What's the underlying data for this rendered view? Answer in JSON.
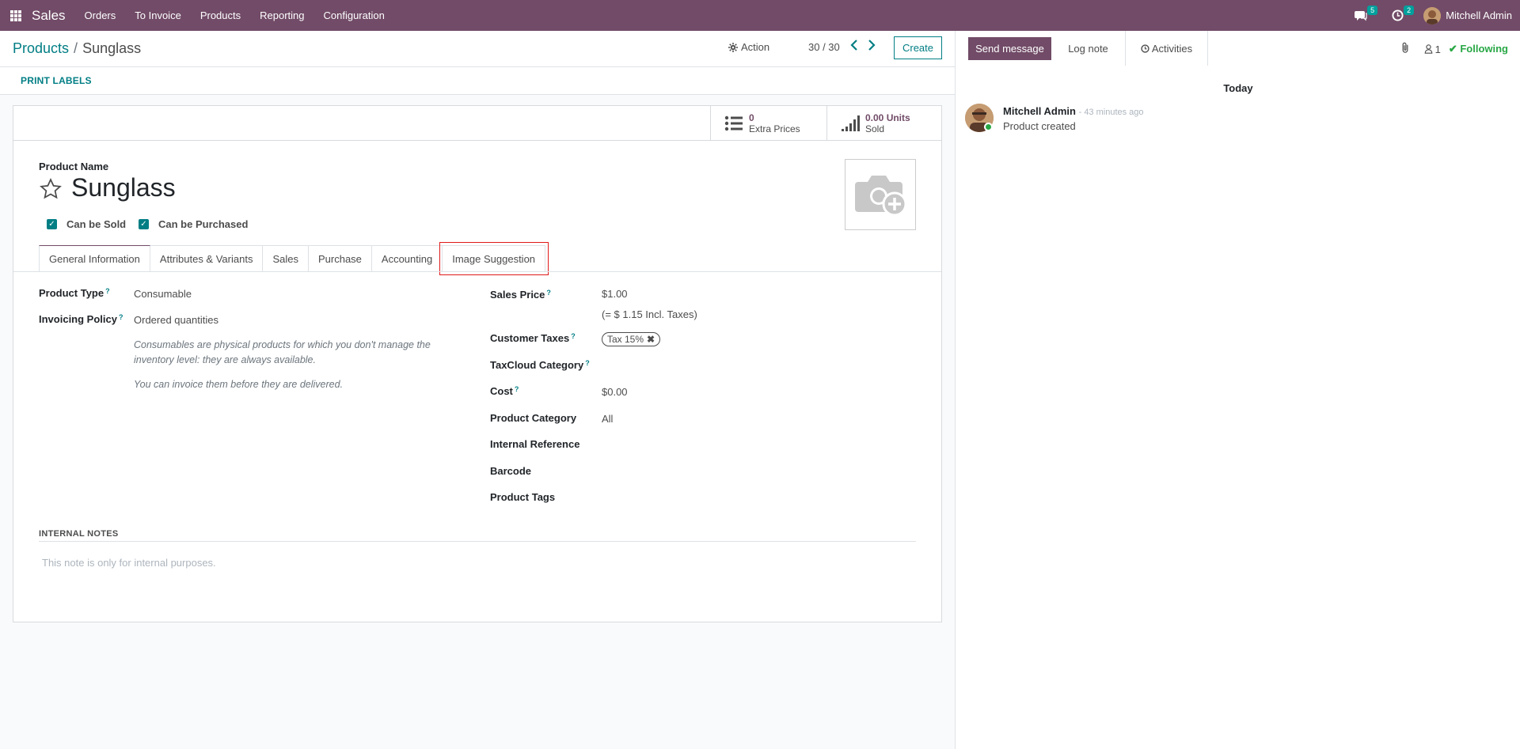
{
  "navbar": {
    "brand": "Sales",
    "menu": [
      "Orders",
      "To Invoice",
      "Products",
      "Reporting",
      "Configuration"
    ],
    "messages_count": "5",
    "activities_count": "2",
    "user": "Mitchell Admin"
  },
  "control": {
    "breadcrumb_parent": "Products",
    "breadcrumb_sep": "/",
    "breadcrumb_current": "Sunglass",
    "action_label": "Action",
    "pager": "30 / 30",
    "create_label": "Create"
  },
  "statusbar": {
    "print_labels": "PRINT LABELS"
  },
  "smart_buttons": {
    "extra_prices_value": "0",
    "extra_prices_label": "Extra Prices",
    "sold_value": "0.00 Units",
    "sold_label": "Sold"
  },
  "product": {
    "name_label": "Product Name",
    "name": "Sunglass",
    "can_be_sold": "Can be Sold",
    "can_be_purchased": "Can be Purchased"
  },
  "tabs": [
    "General Information",
    "Attributes & Variants",
    "Sales",
    "Purchase",
    "Accounting",
    "Image Suggestion"
  ],
  "fields": {
    "product_type_label": "Product Type",
    "product_type": "Consumable",
    "invoicing_policy_label": "Invoicing Policy",
    "invoicing_policy": "Ordered quantities",
    "consumable_note": "Consumables are physical products for which you don't manage the inventory level: they are always available.",
    "invoice_note": "You can invoice them before they are delivered.",
    "sales_price_label": "Sales Price",
    "sales_price": "$1.00",
    "incl_taxes": "(= $ 1.15 Incl. Taxes)",
    "customer_taxes_label": "Customer Taxes",
    "customer_tax_tag": "Tax 15%",
    "taxcloud_label": "TaxCloud Category",
    "cost_label": "Cost",
    "cost": "$0.00",
    "category_label": "Product Category",
    "category": "All",
    "internal_ref_label": "Internal Reference",
    "barcode_label": "Barcode",
    "tags_label": "Product Tags",
    "help_mark": "?"
  },
  "internal_notes": {
    "label": "INTERNAL NOTES",
    "placeholder": "This note is only for internal purposes."
  },
  "chatter": {
    "send_message": "Send message",
    "log_note": "Log note",
    "activities": "Activities",
    "followers_count": "1",
    "following": "Following",
    "today": "Today",
    "author": "Mitchell Admin",
    "time": "- 43 minutes ago",
    "body": "Product created"
  }
}
